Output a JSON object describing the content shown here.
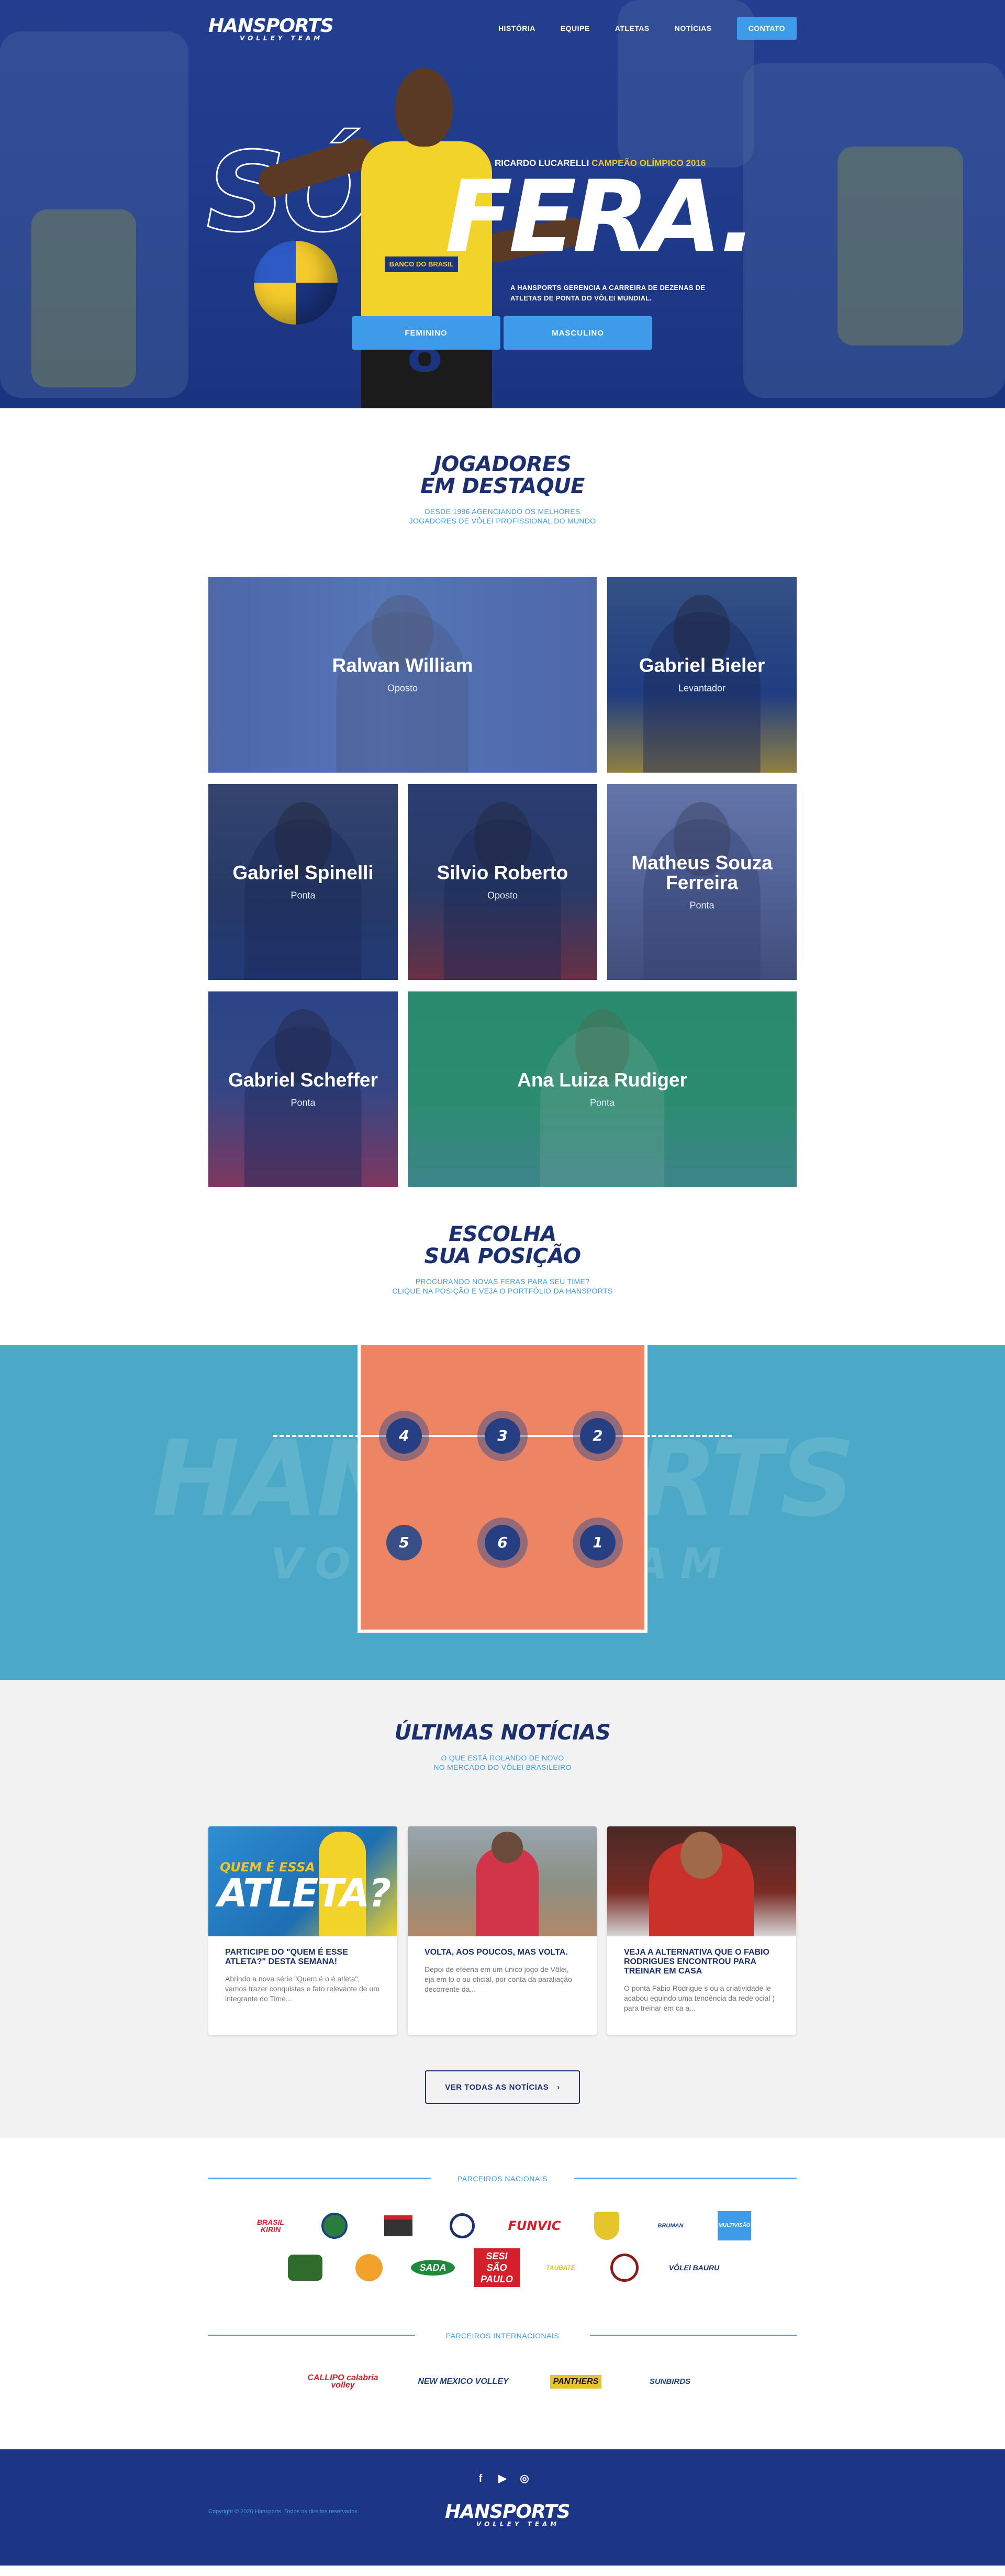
{
  "nav": {
    "logo_main": "HANSPORTS",
    "logo_sub": "VOLLEY TEAM",
    "items": [
      "HISTÓRIA",
      "EQUIPE",
      "ATLETAS",
      "NOTÍCIAS"
    ],
    "contact": "CONTATO"
  },
  "hero": {
    "word1": "SÓ",
    "word2": "FERA.",
    "caption_name": "RICARDO LUCARELLI",
    "caption_title": "CAMPEÃO OLÍMPICO 2016",
    "description": "A HANSPORTS GERENCIA A CARREIRA DE DEZENAS DE ATLETAS DE PONTA DO VÔLEI MUNDIAL.",
    "btn_female": "FEMININO",
    "btn_male": "MASCULINO",
    "jersey_number": "8",
    "jersey_sponsor": "BANCO DO BRASIL"
  },
  "featured": {
    "title_line1": "JOGADORES",
    "title_line2": "EM DESTAQUE",
    "subtitle_line1": "DESDE 1996 AGENCIANDO OS MELHORES",
    "subtitle_line2": "JOGADORES DE VÔLEI PROFISSIONAL DO MUNDO",
    "players": [
      {
        "name": "Ralwan William",
        "position": "Oposto"
      },
      {
        "name": "Gabriel Bieler",
        "position": "Levantador"
      },
      {
        "name": "Gabriel Spinelli",
        "position": "Ponta"
      },
      {
        "name": "Silvio Roberto",
        "position": "Oposto"
      },
      {
        "name": "Matheus Souza Ferreira",
        "position": "Ponta"
      },
      {
        "name": "Gabriel Scheffer",
        "position": "Ponta"
      },
      {
        "name": "Ana Luiza Rudiger",
        "position": "Ponta"
      }
    ]
  },
  "positions": {
    "title_line1": "ESCOLHA",
    "title_line2": "SUA POSIÇÃO",
    "subtitle_line1": "PROCURANDO NOVAS FERAS PARA SEU TIME?",
    "subtitle_line2": "CLIQUE NA POSIÇÃO E VEJA O PORTFÓLIO DA HANSPORTS",
    "numbers": [
      "4",
      "3",
      "2",
      "5",
      "6",
      "1"
    ],
    "watermark_main": "HANSPORTS",
    "watermark_sub": "VOLLEY TEAM"
  },
  "news": {
    "title": "ÚLTIMAS NOTÍCIAS",
    "subtitle_line1": "O QUE ESTÁ ROLANDO DE NOVO",
    "subtitle_line2": "NO MERCADO DO VÔLEI BRASILEIRO",
    "image_overlay_small": "QUEM É ESSA",
    "image_overlay_big": "ATLETA?",
    "items": [
      {
        "title": "PARTICIPE DO \"QUEM É ESSE ATLETA?\" DESTA SEMANA!",
        "text": "Abrindo a nova série \"Quem é o é atleta\", vamos trazer conquistas e fato relevante de um integrante do Time..."
      },
      {
        "title": "VOLTA, AOS POUCOS, MAS VOLTA.",
        "text": "Depoi de efeena em um único jogo de Vôlei, eja em lo o ou oficial, por conta da paraliação decorrente da..."
      },
      {
        "title": "VEJA A ALTERNATIVA QUE O FABIO RODRIGUES ENCONTROU PARA TREINAR EM CASA",
        "text": "O ponta Fabio Rodrigue s ou a criatividade le acabou eguindo uma tendência da rede ocial ) para treinar em ca a..."
      }
    ],
    "see_all": "VER TODAS AS NOTÍCIAS",
    "see_all_icon": "chevron-right-icon"
  },
  "partners": {
    "national_label": "PARCEIROS NACIONAIS",
    "international_label": "PARCEIROS INTERNACIONAIS",
    "national_row1": [
      "BRASIL KIRIN",
      "ESCUDO",
      "BUGRE",
      "FH",
      "FUNVIC",
      "ESCUDO",
      "BRUMAN",
      "MULTIVISÃO"
    ],
    "national_row2": [
      "CAMPO VERDE",
      "MÃO",
      "SADA",
      "SESI SÃO PAULO",
      "TAUBATÉ",
      "ACIC",
      "VÔLEI BAURU"
    ],
    "international": [
      "CALLIPO calabria volley",
      "NEW MEXICO VOLLEY",
      "PANTHERS",
      "SUNBIRDS"
    ]
  },
  "footer": {
    "social_icons": [
      "facebook-icon",
      "youtube-icon",
      "instagram-icon"
    ],
    "copyright": "Copyright © 2020 Hansports. Todos os direitos reservados.",
    "logo_main": "HANSPORTS",
    "logo_sub": "VOLLEY TEAM"
  },
  "colors": {
    "navy": "#1c2f6e",
    "accent_blue": "#3d9be9",
    "hero_blue": "#1f3a8a",
    "court_orange": "#ed8564",
    "court_bg": "#4aa9c6",
    "gold": "#f3c623",
    "footer": "#1c3587"
  }
}
